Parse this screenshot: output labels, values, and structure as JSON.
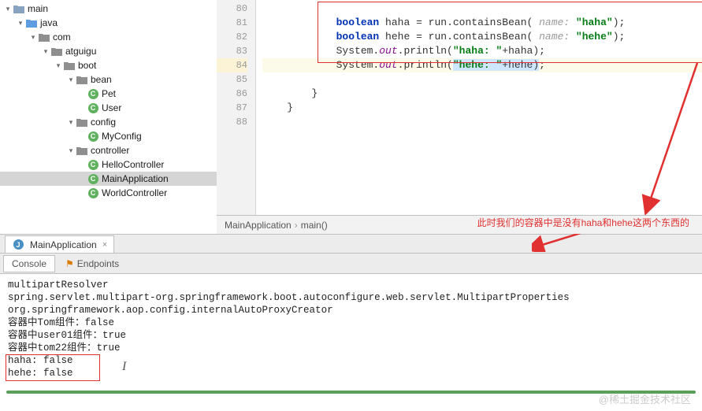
{
  "tree": {
    "main": "main",
    "java": "java",
    "com": "com",
    "atguigu": "atguigu",
    "boot": "boot",
    "bean": "bean",
    "pet": "Pet",
    "user": "User",
    "config": "config",
    "myconfig": "MyConfig",
    "controller": "controller",
    "helloctrl": "HelloController",
    "mainapp": "MainApplication",
    "worldctrl": "WorldController"
  },
  "gutter": [
    "80",
    "81",
    "82",
    "83",
    "84",
    "85",
    "86",
    "87",
    "88"
  ],
  "code": {
    "kw_boolean": "boolean",
    "kw_out": "out",
    "ident_run": "run",
    "m_contains": ".containsBean(",
    "hint": " name: ",
    "v_haha": "haha",
    "v_hehe": "hehe",
    "sys": "System.",
    "print": ".println(",
    "s_haha": "\"haha\"",
    "s_hehe": "\"hehe\"",
    "s_haha_lbl": "\"haha: \"",
    "s_hehe_lbl": "\"hehe: \"",
    "plus": "+",
    ");": ");",
    "eq": " = ",
    "close1": "}",
    "close2": "}",
    "close3": "}"
  },
  "breadcrumb": {
    "a": "MainApplication",
    "b": "main()"
  },
  "annotation": "此时我们的容器中是没有haha和hehe这两个东西的",
  "tab": {
    "title": "MainApplication",
    "close": "×"
  },
  "subtabs": {
    "console": "Console",
    "endpoints": "Endpoints"
  },
  "out": [
    "multipartResolver",
    "spring.servlet.multipart-org.springframework.boot.autoconfigure.web.servlet.MultipartProperties",
    "org.springframework.aop.config.internalAutoProxyCreator",
    "容器中Tom组件：false",
    "容器中user01组件：true",
    "容器中tom22组件：true",
    "haha: false",
    "hehe: false"
  ],
  "watermark": "@稀土掘金技术社区"
}
